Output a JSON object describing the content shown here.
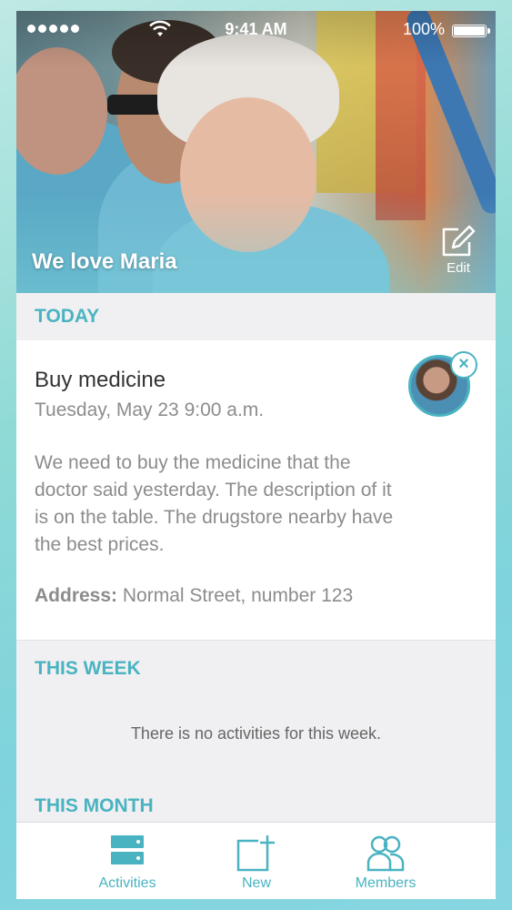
{
  "status_bar": {
    "time": "9:41 AM",
    "battery": "100%"
  },
  "hero": {
    "title": "We love Maria",
    "edit_label": "Edit"
  },
  "sections": {
    "today": "TODAY",
    "this_week": "THIS WEEK",
    "this_month": "THIS MONTH"
  },
  "activity": {
    "title": "Buy medicine",
    "date": "Tuesday, May 23 9:00 a.m.",
    "description": "We need to buy the medicine that the doctor said yesterday. The description of it is on the table. The drugstore nearby have the best prices.",
    "address_label": "Address:",
    "address_value": " Normal Street, number 123"
  },
  "this_week": {
    "empty_message": "There is no activities for this week."
  },
  "tab_bar": {
    "items": [
      {
        "label": "Activities",
        "icon": "activities-icon"
      },
      {
        "label": "New",
        "icon": "new-icon"
      },
      {
        "label": "Members",
        "icon": "members-icon"
      }
    ]
  },
  "colors": {
    "accent": "#4ab3c1",
    "text_primary": "#333333",
    "text_secondary": "#8c8c8c",
    "background": "#f0f0f2"
  }
}
